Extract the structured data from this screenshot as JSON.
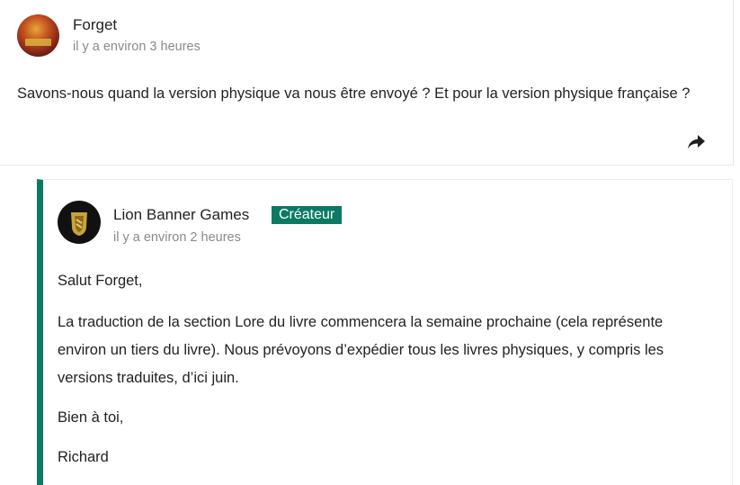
{
  "comment": {
    "author": "Forget",
    "time": "il y a environ 3 heures",
    "text": "Savons-nous quand la version physique va nous être envoyé ? Et pour la version physique française ?"
  },
  "reply": {
    "author": "Lion Banner Games",
    "badge": "Créateur",
    "time": "il y a environ 2 heures",
    "paragraphs": [
      "Salut Forget,",
      "La traduction de la section Lore du livre commencera la semaine prochaine (cela représente environ un tiers du livre). Nous prévoyons d’expédier tous les livres physiques, y compris les versions traduites, d’ici juin.",
      "Bien à toi,",
      "Richard"
    ]
  },
  "colors": {
    "accent": "#0b7a63",
    "muted_text": "#8a8a8a",
    "text": "#222222"
  },
  "icons": {
    "share": "share-icon",
    "avatar_forget": "user-avatar",
    "avatar_lion": "lion-banner-logo-icon"
  }
}
